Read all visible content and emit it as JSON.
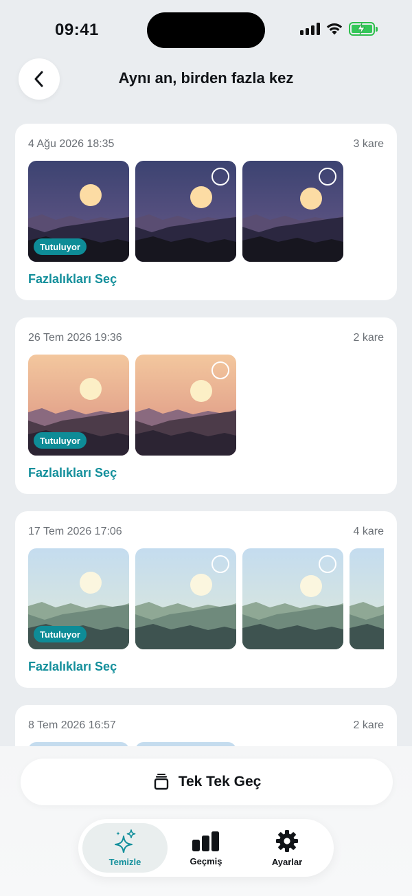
{
  "status_bar": {
    "time": "09:41"
  },
  "header": {
    "title": "Aynı an, birden fazla kez",
    "back_icon": "chevron-left-icon"
  },
  "colors": {
    "accent": "#138f9b",
    "badge": "#0e8c97",
    "background": "#eaedf0"
  },
  "groups": [
    {
      "date": "4 Ağu 2026 18:35",
      "count": "3 kare",
      "theme": "dusk",
      "keep_badge": "Tutuluyor",
      "action": "Fazlalıkları Seç"
    },
    {
      "date": "26 Tem 2026 19:36",
      "count": "2 kare",
      "theme": "sunset",
      "keep_badge": "Tutuluyor",
      "action": "Fazlalıkları Seç"
    },
    {
      "date": "17 Tem 2026 17:06",
      "count": "4 kare",
      "theme": "day",
      "keep_badge": "Tutuluyor",
      "action": "Fazlalıkları Seç"
    },
    {
      "date": "8 Tem 2026 16:57",
      "count": "2 kare",
      "theme": "day"
    }
  ],
  "swipe_button": {
    "label": "Tek Tek Geç",
    "icon": "stack-icon"
  },
  "tab_bar": {
    "tabs": [
      {
        "label": "Temizle",
        "icon": "sparkles-icon",
        "active": true
      },
      {
        "label": "Geçmiş",
        "icon": "bar-chart-icon",
        "active": false
      },
      {
        "label": "Ayarlar",
        "icon": "gear-icon",
        "active": false
      }
    ]
  }
}
